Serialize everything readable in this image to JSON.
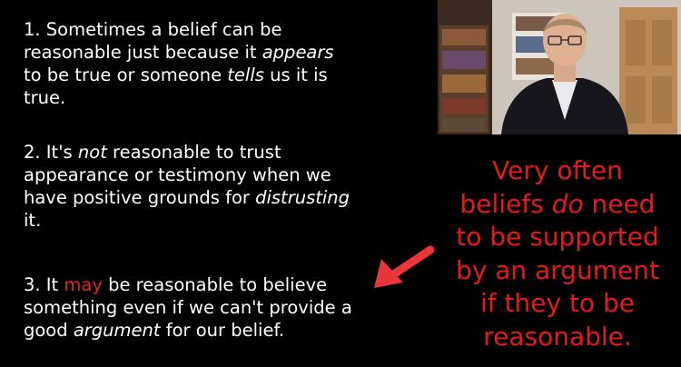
{
  "points": [
    {
      "segments": [
        {
          "text": "1. Sometimes a belief can be reasonable just because it "
        },
        {
          "text": "appears",
          "style": "italic"
        },
        {
          "text": " to be true or someone "
        },
        {
          "text": "tells",
          "style": "italic"
        },
        {
          "text": " us it is true."
        }
      ]
    },
    {
      "segments": [
        {
          "text": "2. It's "
        },
        {
          "text": "not",
          "style": "italic"
        },
        {
          "text": " reasonable to trust appearance or testimony when we have positive grounds for "
        },
        {
          "text": "distrusting",
          "style": "italic"
        },
        {
          "text": " it."
        }
      ]
    },
    {
      "segments": [
        {
          "text": "3. It "
        },
        {
          "text": "may",
          "style": "red"
        },
        {
          "text": " be reasonable to believe something even if we can't provide a good "
        },
        {
          "text": "argument",
          "style": "italic"
        },
        {
          "text": " for our belief."
        }
      ]
    }
  ],
  "lines": {
    "p1": [
      "1. Sometimes a belief can be",
      "reasonable just because it |appears|",
      "to be true or someone |tells| us it is",
      "true."
    ],
    "p2": [
      "2. It's |not| reasonable to trust",
      "appearance or testimony when we",
      "have positive grounds for |distrusting|",
      "it."
    ],
    "p3": [
      "3. It ^may^ be reasonable to believe",
      "something even if we can't provide a",
      "good |argument| for our belief."
    ]
  },
  "callout": {
    "lines": [
      "Very often",
      "beliefs |do| need",
      "to be supported",
      "by an argument",
      "if they to be",
      "reasonable."
    ],
    "color": "#e31b1b"
  },
  "arrow": {
    "color": "#e8363a",
    "icon": "arrow-pointing-left-down-icon"
  },
  "video": {
    "description_icon": "presenter-video-icon"
  }
}
